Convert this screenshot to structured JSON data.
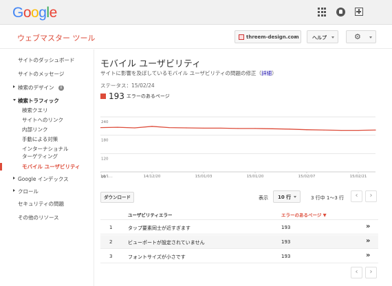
{
  "header": {
    "logo": [
      "G",
      "o",
      "o",
      "g",
      "l",
      "e"
    ],
    "logo_colors": [
      "#4285f4",
      "#ea4335",
      "#fbbc05",
      "#4285f4",
      "#34a853",
      "#ea4335"
    ],
    "product": "ウェブマスター ツール",
    "site": "threem-design.com",
    "help": "ヘルプ"
  },
  "sidebar": {
    "items": [
      {
        "label": "サイトのダッシュボード"
      },
      {
        "label": "サイトのメッセージ"
      },
      {
        "label": "検索のデザイン"
      },
      {
        "label": "検索トラフィック"
      },
      {
        "label": "検索クエリ"
      },
      {
        "label": "サイトへのリンク"
      },
      {
        "label": "内部リンク"
      },
      {
        "label": "手動による対策"
      },
      {
        "label": "インターナショナル ターゲティング"
      },
      {
        "label": "モバイル ユーザビリティ"
      },
      {
        "label": "Google インデックス"
      },
      {
        "label": "クロール"
      },
      {
        "label": "セキュリティの問題"
      },
      {
        "label": "その他のリソース"
      }
    ],
    "info_glyph": "i"
  },
  "main": {
    "title": "モバイル ユーザビリティ",
    "description": "サイトに影響を及ぼしているモバイル ユーザビリティの問題の修正（",
    "details_link": "詳細",
    "description_end": "）",
    "status": "ステータス：15/02/24",
    "legend_count": "193",
    "legend_label": "エラーのあるページ",
    "download": "ダウンロード",
    "show": "表示",
    "rows": "10 行",
    "range": "3 行中 1〜3 行",
    "prev": "‹",
    "next": "›"
  },
  "table": {
    "col_issue": "ユーザビリティエラー",
    "col_pages": "エラーのあるページ ▼",
    "go": "»",
    "rows": [
      {
        "num": "1",
        "name": "タップ要素同士が近すぎます",
        "value": "193"
      },
      {
        "num": "2",
        "name": "ビューポートが設定されていません",
        "value": "193"
      },
      {
        "num": "3",
        "name": "フォントサイズが小さです",
        "value": "193"
      }
    ]
  },
  "chart_data": {
    "type": "line",
    "title": "",
    "xlabel": "",
    "ylabel": "",
    "ylim": [
      60,
      240
    ],
    "yticks": [
      "240",
      "180",
      "120",
      "60"
    ],
    "xticks": [
      "14/1…",
      "14/12/20",
      "15/01/03",
      "15/01/20",
      "15/02/07",
      "15/02/21"
    ],
    "x": [
      "14/1…",
      "",
      "",
      "14/12/20",
      "",
      "",
      "15/01/03",
      "",
      "",
      "15/01/20",
      "",
      "",
      "15/02/07",
      "",
      "",
      "15/02/21",
      ""
    ],
    "series": [
      {
        "values": [
          205,
          206,
          204,
          209,
          205,
          204,
          203,
          203,
          202,
          202,
          201,
          200,
          198,
          197,
          196,
          196,
          197
        ]
      }
    ],
    "grid": true,
    "color": "#dd4b39"
  }
}
